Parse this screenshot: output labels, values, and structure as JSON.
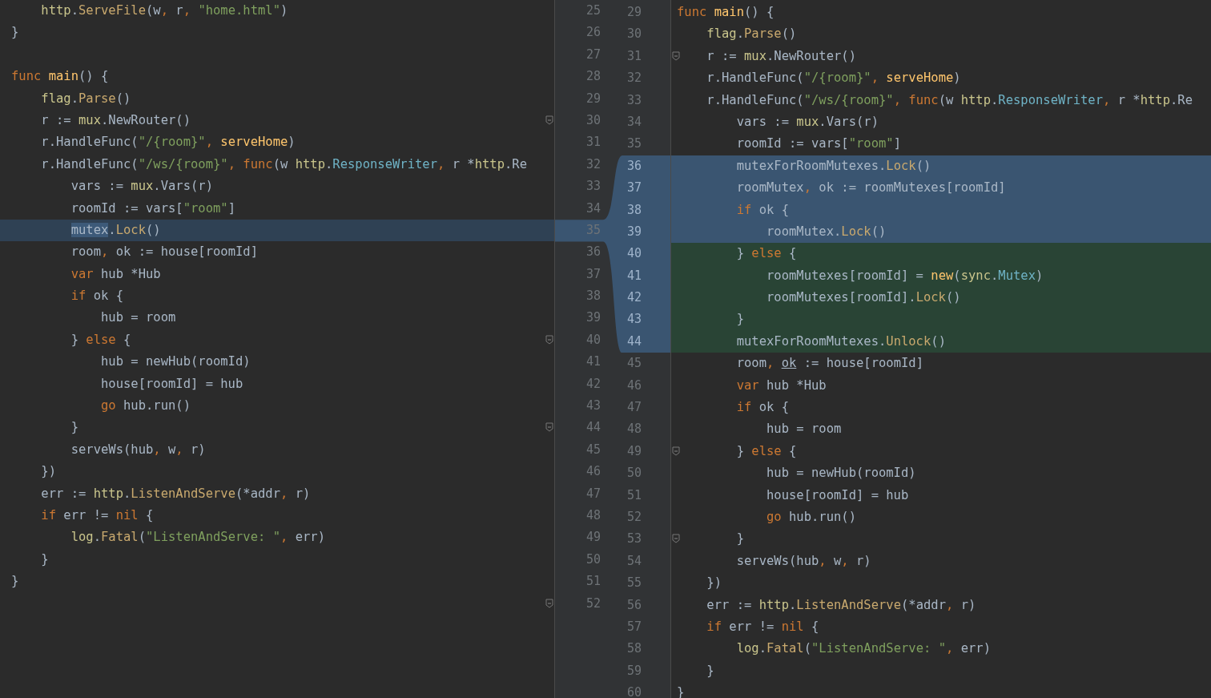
{
  "left": {
    "lines": [
      {
        "number": "25",
        "tokens": [
          {
            "kind": "package",
            "text": "    http"
          },
          {
            "text": "."
          },
          {
            "kind": "method",
            "text": "ServeFile"
          },
          {
            "text": "(w"
          },
          {
            "kind": "comma",
            "text": ","
          },
          {
            "text": " r"
          },
          {
            "kind": "comma",
            "text": ", "
          },
          {
            "kind": "string",
            "text": "\"home.html\""
          },
          {
            "text": ")"
          }
        ]
      },
      {
        "number": "26",
        "tokens": [
          {
            "text": "}"
          }
        ]
      },
      {
        "number": "27"
      },
      {
        "number": "28",
        "tokens": [
          {
            "kind": "keyword",
            "text": "func"
          },
          {
            "kind": "function",
            "text": " main"
          },
          {
            "text": "() {"
          }
        ]
      },
      {
        "number": "29",
        "tokens": [
          {
            "kind": "package",
            "text": "    flag"
          },
          {
            "text": "."
          },
          {
            "kind": "method",
            "text": "Parse"
          },
          {
            "text": "()"
          }
        ]
      },
      {
        "number": "30",
        "fold": true,
        "tokens": [
          {
            "text": "    r := "
          },
          {
            "kind": "package",
            "text": "mux"
          },
          {
            "text": ".NewRouter()"
          }
        ]
      },
      {
        "number": "31",
        "tokens": [
          {
            "text": "    r.HandleFunc("
          },
          {
            "kind": "string",
            "text": "\"/{room}\""
          },
          {
            "kind": "comma",
            "text": ", "
          },
          {
            "kind": "function",
            "text": "serveHome"
          },
          {
            "text": ")"
          }
        ]
      },
      {
        "number": "32",
        "tokens": [
          {
            "text": "    r.HandleFunc("
          },
          {
            "kind": "string",
            "text": "\"/ws/{room}\""
          },
          {
            "kind": "comma",
            "text": ", "
          },
          {
            "kind": "keyword",
            "text": "func"
          },
          {
            "text": "(w "
          },
          {
            "kind": "package",
            "text": "http"
          },
          {
            "text": "."
          },
          {
            "kind": "type",
            "text": "ResponseWriter"
          },
          {
            "kind": "comma",
            "text": ","
          },
          {
            "text": " r *"
          },
          {
            "kind": "package",
            "text": "http"
          },
          {
            "text": ".Re"
          }
        ]
      },
      {
        "number": "33",
        "tokens": [
          {
            "text": "        vars := "
          },
          {
            "kind": "package",
            "text": "mux"
          },
          {
            "text": ".Vars(r)"
          }
        ]
      },
      {
        "number": "34",
        "tokens": [
          {
            "text": "        roomId := vars["
          },
          {
            "kind": "string",
            "text": "\"room\""
          },
          {
            "text": "]"
          }
        ]
      },
      {
        "number": "35",
        "kind": "modified",
        "tokens": [
          {
            "kind": "selected",
            "text": "        mutex"
          },
          {
            "text": "."
          },
          {
            "kind": "method",
            "text": "Lock"
          },
          {
            "text": "()"
          }
        ]
      },
      {
        "number": "36",
        "tokens": [
          {
            "text": "        room"
          },
          {
            "kind": "comma",
            "text": ","
          },
          {
            "text": " ok := house[roomId]"
          }
        ]
      },
      {
        "number": "37",
        "tokens": [
          {
            "kind": "keyword",
            "text": "        var"
          },
          {
            "text": " hub *Hub"
          }
        ]
      },
      {
        "number": "38",
        "tokens": [
          {
            "kind": "keyword",
            "text": "        if"
          },
          {
            "text": " ok {"
          }
        ]
      },
      {
        "number": "39",
        "tokens": [
          {
            "text": "            hub = room"
          }
        ]
      },
      {
        "number": "40",
        "fold": true,
        "tokens": [
          {
            "text": "        } "
          },
          {
            "kind": "keyword",
            "text": "else"
          },
          {
            "text": " {"
          }
        ]
      },
      {
        "number": "41",
        "tokens": [
          {
            "text": "            hub = newHub(roomId)"
          }
        ]
      },
      {
        "number": "42",
        "tokens": [
          {
            "text": "            house[roomId] = hub"
          }
        ]
      },
      {
        "number": "43",
        "tokens": [
          {
            "kind": "keyword",
            "text": "            go"
          },
          {
            "text": " hub.run()"
          }
        ]
      },
      {
        "number": "44",
        "fold": true,
        "tokens": [
          {
            "text": "        }"
          }
        ]
      },
      {
        "number": "45",
        "tokens": [
          {
            "text": "        serveWs(hub"
          },
          {
            "kind": "comma",
            "text": ","
          },
          {
            "text": " w"
          },
          {
            "kind": "comma",
            "text": ","
          },
          {
            "text": " r)"
          }
        ]
      },
      {
        "number": "46",
        "tokens": [
          {
            "text": "    })"
          }
        ]
      },
      {
        "number": "47",
        "tokens": [
          {
            "text": "    err := "
          },
          {
            "kind": "package",
            "text": "http"
          },
          {
            "text": "."
          },
          {
            "kind": "method",
            "text": "ListenAndServe"
          },
          {
            "text": "(*addr"
          },
          {
            "kind": "comma",
            "text": ","
          },
          {
            "text": " r)"
          }
        ]
      },
      {
        "number": "48",
        "tokens": [
          {
            "kind": "keyword",
            "text": "    if"
          },
          {
            "text": " err != "
          },
          {
            "kind": "keyword",
            "text": "nil"
          },
          {
            "text": " {"
          }
        ]
      },
      {
        "number": "49",
        "tokens": [
          {
            "kind": "package",
            "text": "        log"
          },
          {
            "text": "."
          },
          {
            "kind": "method",
            "text": "Fatal"
          },
          {
            "text": "("
          },
          {
            "kind": "string",
            "text": "\"ListenAndServe: \""
          },
          {
            "kind": "comma",
            "text": ","
          },
          {
            "text": " err)"
          }
        ]
      },
      {
        "number": "50",
        "tokens": [
          {
            "text": "    }"
          }
        ]
      },
      {
        "number": "51",
        "tokens": [
          {
            "text": "}"
          }
        ]
      },
      {
        "number": "52",
        "fold": true
      }
    ]
  },
  "right": {
    "lines": [
      {
        "number": "29",
        "tokens": [
          {
            "kind": "keyword",
            "text": "func"
          },
          {
            "kind": "function",
            "text": " main"
          },
          {
            "text": "() {"
          }
        ]
      },
      {
        "number": "30",
        "tokens": [
          {
            "kind": "package",
            "text": "    flag"
          },
          {
            "text": "."
          },
          {
            "kind": "method",
            "text": "Parse"
          },
          {
            "text": "()"
          }
        ]
      },
      {
        "number": "31",
        "fold": true,
        "tokens": [
          {
            "text": "    r := "
          },
          {
            "kind": "package",
            "text": "mux"
          },
          {
            "text": ".NewRouter()"
          }
        ]
      },
      {
        "number": "32",
        "tokens": [
          {
            "text": "    r.HandleFunc("
          },
          {
            "kind": "string",
            "text": "\"/{room}\""
          },
          {
            "kind": "comma",
            "text": ", "
          },
          {
            "kind": "function",
            "text": "serveHome"
          },
          {
            "text": ")"
          }
        ]
      },
      {
        "number": "33",
        "tokens": [
          {
            "text": "    r.HandleFunc("
          },
          {
            "kind": "string",
            "text": "\"/ws/{room}\""
          },
          {
            "kind": "comma",
            "text": ", "
          },
          {
            "kind": "keyword",
            "text": "func"
          },
          {
            "text": "(w "
          },
          {
            "kind": "package",
            "text": "http"
          },
          {
            "text": "."
          },
          {
            "kind": "type",
            "text": "ResponseWriter"
          },
          {
            "kind": "comma",
            "text": ","
          },
          {
            "text": " r *"
          },
          {
            "kind": "package",
            "text": "http"
          },
          {
            "text": ".Re"
          }
        ]
      },
      {
        "number": "34",
        "tokens": [
          {
            "text": "        vars := "
          },
          {
            "kind": "package",
            "text": "mux"
          },
          {
            "text": ".Vars(r)"
          }
        ]
      },
      {
        "number": "35",
        "tokens": [
          {
            "text": "        roomId := vars["
          },
          {
            "kind": "string",
            "text": "\"room\""
          },
          {
            "text": "]"
          }
        ]
      },
      {
        "number": "36",
        "kind": "modified",
        "tokens": [
          {
            "text": "        mutexForRoomMutexes."
          },
          {
            "kind": "method",
            "text": "Lock"
          },
          {
            "text": "()"
          }
        ]
      },
      {
        "number": "37",
        "kind": "modified",
        "tokens": [
          {
            "text": "        roomMutex"
          },
          {
            "kind": "comma",
            "text": ","
          },
          {
            "text": " ok := roomMutexes[roomId]"
          }
        ]
      },
      {
        "number": "38",
        "kind": "modified",
        "tokens": [
          {
            "kind": "keyword",
            "text": "        if"
          },
          {
            "text": " ok {"
          }
        ]
      },
      {
        "number": "39",
        "kind": "modified",
        "tokens": [
          {
            "text": "            roomMutex."
          },
          {
            "kind": "method",
            "text": "Lock"
          },
          {
            "text": "()"
          }
        ]
      },
      {
        "number": "40",
        "kind": "added",
        "tokens": [
          {
            "text": "        } "
          },
          {
            "kind": "keyword",
            "text": "else"
          },
          {
            "text": " {"
          }
        ]
      },
      {
        "number": "41",
        "kind": "added",
        "tokens": [
          {
            "text": "            roomMutexes[roomId] = "
          },
          {
            "kind": "function",
            "text": "new"
          },
          {
            "text": "("
          },
          {
            "kind": "package",
            "text": "sync"
          },
          {
            "text": "."
          },
          {
            "kind": "type",
            "text": "Mutex"
          },
          {
            "text": ")"
          }
        ]
      },
      {
        "number": "42",
        "kind": "added",
        "tokens": [
          {
            "text": "            roomMutexes[roomId]."
          },
          {
            "kind": "method",
            "text": "Lock"
          },
          {
            "text": "()"
          }
        ]
      },
      {
        "number": "43",
        "kind": "added",
        "tokens": [
          {
            "text": "        }"
          }
        ]
      },
      {
        "number": "44",
        "kind": "added",
        "tokens": [
          {
            "text": "        mutexForRoomMutexes."
          },
          {
            "kind": "method",
            "text": "Unlock"
          },
          {
            "text": "()"
          }
        ]
      },
      {
        "number": "45",
        "tokens": [
          {
            "text": "        room"
          },
          {
            "kind": "comma",
            "text": ", "
          },
          {
            "kind": "underlined",
            "text": "ok"
          },
          {
            "text": " := house[roomId]"
          }
        ]
      },
      {
        "number": "46",
        "tokens": [
          {
            "kind": "keyword",
            "text": "        var"
          },
          {
            "text": " hub *Hub"
          }
        ]
      },
      {
        "number": "47",
        "tokens": [
          {
            "kind": "keyword",
            "text": "        if"
          },
          {
            "text": " ok {"
          }
        ]
      },
      {
        "number": "48",
        "tokens": [
          {
            "text": "            hub = room"
          }
        ]
      },
      {
        "number": "49",
        "fold": true,
        "tokens": [
          {
            "text": "        } "
          },
          {
            "kind": "keyword",
            "text": "else"
          },
          {
            "text": " {"
          }
        ]
      },
      {
        "number": "50",
        "tokens": [
          {
            "text": "            hub = newHub(roomId)"
          }
        ]
      },
      {
        "number": "51",
        "tokens": [
          {
            "text": "            house[roomId] = hub"
          }
        ]
      },
      {
        "number": "52",
        "tokens": [
          {
            "kind": "keyword",
            "text": "            go"
          },
          {
            "text": " hub.run()"
          }
        ]
      },
      {
        "number": "53",
        "fold": true,
        "tokens": [
          {
            "text": "        }"
          }
        ]
      },
      {
        "number": "54",
        "tokens": [
          {
            "text": "        serveWs(hub"
          },
          {
            "kind": "comma",
            "text": ","
          },
          {
            "text": " w"
          },
          {
            "kind": "comma",
            "text": ","
          },
          {
            "text": " r)"
          }
        ]
      },
      {
        "number": "55",
        "tokens": [
          {
            "text": "    })"
          }
        ]
      },
      {
        "number": "56",
        "tokens": [
          {
            "text": "    err := "
          },
          {
            "kind": "package",
            "text": "http"
          },
          {
            "text": "."
          },
          {
            "kind": "method",
            "text": "ListenAndServe"
          },
          {
            "text": "(*addr"
          },
          {
            "kind": "comma",
            "text": ","
          },
          {
            "text": " r)"
          }
        ]
      },
      {
        "number": "57",
        "tokens": [
          {
            "kind": "keyword",
            "text": "    if"
          },
          {
            "text": " err != "
          },
          {
            "kind": "keyword",
            "text": "nil"
          },
          {
            "text": " {"
          }
        ]
      },
      {
        "number": "58",
        "tokens": [
          {
            "kind": "package",
            "text": "        log"
          },
          {
            "text": "."
          },
          {
            "kind": "method",
            "text": "Fatal"
          },
          {
            "text": "("
          },
          {
            "kind": "string",
            "text": "\"ListenAndServe: \""
          },
          {
            "kind": "comma",
            "text": ","
          },
          {
            "text": " err)"
          }
        ]
      },
      {
        "number": "59",
        "tokens": [
          {
            "text": "    }"
          }
        ]
      },
      {
        "number": "60",
        "tokens": [
          {
            "text": "}"
          }
        ]
      }
    ]
  }
}
